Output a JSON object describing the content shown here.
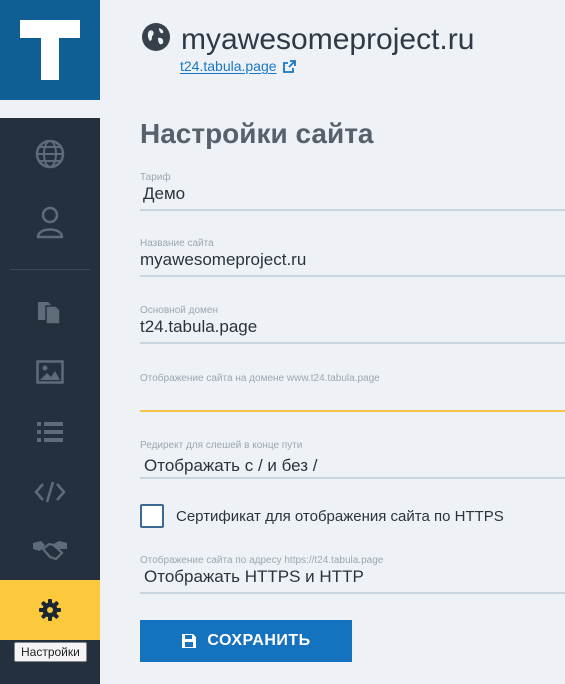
{
  "header": {
    "site_name": "myawesomeproject.ru",
    "site_link": "t24.tabula.page"
  },
  "sidebar": {
    "logo_letter": "T",
    "items": [
      {
        "icon": "globe-icon"
      },
      {
        "icon": "user-icon"
      },
      {
        "icon": "pages-icon"
      },
      {
        "icon": "image-icon"
      },
      {
        "icon": "list-icon"
      },
      {
        "icon": "code-icon"
      },
      {
        "icon": "handshake-icon"
      },
      {
        "icon": "gear-icon",
        "active": true
      }
    ],
    "tooltip": "Настройки"
  },
  "page": {
    "title": "Настройки сайта"
  },
  "fields": {
    "plan": {
      "label": "Тариф",
      "value": "Демо"
    },
    "site_name": {
      "label": "Название сайта",
      "value": "myawesomeproject.ru"
    },
    "main_domain": {
      "label": "Основной домен",
      "value": "t24.tabula.page"
    },
    "domain_display": {
      "label": "Отображение сайта на домене www.t24.tabula.page",
      "value": ""
    },
    "trailing_slash": {
      "label": "Редирект для слешей в конце пути",
      "value": "Отображать с / и без /"
    },
    "https_cert": {
      "label": "Сертификат для отображения сайта по HTTPS",
      "checked": false
    },
    "https_display": {
      "label": "Отображение сайта по адресу https://t24.tabula.page",
      "value": "Отображать HTTPS и HTTP"
    }
  },
  "actions": {
    "save_label": "СОХРАНИТЬ"
  },
  "colors": {
    "sidebar": "#24303d",
    "logo_bg": "#0f5f95",
    "active_nav": "#fcc93c",
    "primary": "#1572be",
    "link": "#1877c4",
    "focus_underline": "#f4c24a"
  }
}
